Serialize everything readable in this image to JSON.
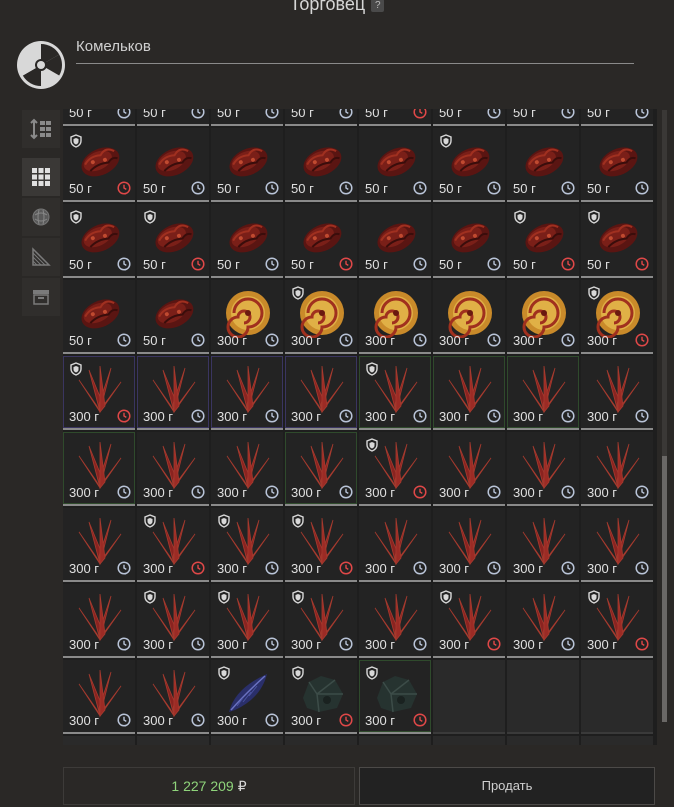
{
  "header": {
    "title": "Торговец",
    "help": "?"
  },
  "trader": {
    "name": "Комельков"
  },
  "toolbar": {
    "items": [
      "sort-icon",
      "grid-view-icon",
      "orb-filter-icon",
      "pattern-filter-icon",
      "box-filter-icon"
    ]
  },
  "colors": {
    "price_total": "#8fd47b",
    "clock_normal": "#b9c4d8",
    "clock_expiring": "#e04848"
  },
  "inventory": {
    "items": [
      {
        "price": "50 г",
        "type": "meat",
        "lock": false,
        "exp": false,
        "rar": ""
      },
      {
        "price": "50 г",
        "type": "meat",
        "lock": false,
        "exp": false,
        "rar": ""
      },
      {
        "price": "50 г",
        "type": "meat",
        "lock": false,
        "exp": false,
        "rar": ""
      },
      {
        "price": "50 г",
        "type": "meat",
        "lock": false,
        "exp": false,
        "rar": ""
      },
      {
        "price": "50 г",
        "type": "meat",
        "lock": false,
        "exp": true,
        "rar": ""
      },
      {
        "price": "50 г",
        "type": "meat",
        "lock": false,
        "exp": false,
        "rar": ""
      },
      {
        "price": "50 г",
        "type": "meat",
        "lock": false,
        "exp": false,
        "rar": ""
      },
      {
        "price": "50 г",
        "type": "meat",
        "lock": false,
        "exp": false,
        "rar": ""
      },
      {
        "price": "50 г",
        "type": "meat",
        "lock": true,
        "exp": true,
        "rar": ""
      },
      {
        "price": "50 г",
        "type": "meat",
        "lock": false,
        "exp": false,
        "rar": ""
      },
      {
        "price": "50 г",
        "type": "meat",
        "lock": false,
        "exp": false,
        "rar": ""
      },
      {
        "price": "50 г",
        "type": "meat",
        "lock": false,
        "exp": false,
        "rar": ""
      },
      {
        "price": "50 г",
        "type": "meat",
        "lock": false,
        "exp": false,
        "rar": ""
      },
      {
        "price": "50 г",
        "type": "meat",
        "lock": true,
        "exp": false,
        "rar": ""
      },
      {
        "price": "50 г",
        "type": "meat",
        "lock": false,
        "exp": false,
        "rar": ""
      },
      {
        "price": "50 г",
        "type": "meat",
        "lock": false,
        "exp": false,
        "rar": ""
      },
      {
        "price": "50 г",
        "type": "meat",
        "lock": true,
        "exp": false,
        "rar": ""
      },
      {
        "price": "50 г",
        "type": "meat",
        "lock": true,
        "exp": true,
        "rar": ""
      },
      {
        "price": "50 г",
        "type": "meat",
        "lock": false,
        "exp": false,
        "rar": ""
      },
      {
        "price": "50 г",
        "type": "meat",
        "lock": false,
        "exp": true,
        "rar": ""
      },
      {
        "price": "50 г",
        "type": "meat",
        "lock": false,
        "exp": false,
        "rar": ""
      },
      {
        "price": "50 г",
        "type": "meat",
        "lock": false,
        "exp": false,
        "rar": ""
      },
      {
        "price": "50 г",
        "type": "meat",
        "lock": true,
        "exp": true,
        "rar": ""
      },
      {
        "price": "50 г",
        "type": "meat",
        "lock": true,
        "exp": true,
        "rar": ""
      },
      {
        "price": "50 г",
        "type": "meat",
        "lock": false,
        "exp": false,
        "rar": ""
      },
      {
        "price": "50 г",
        "type": "meat",
        "lock": false,
        "exp": false,
        "rar": ""
      },
      {
        "price": "300 г",
        "type": "swirl",
        "lock": false,
        "exp": false,
        "rar": ""
      },
      {
        "price": "300 г",
        "type": "swirl",
        "lock": true,
        "exp": false,
        "rar": ""
      },
      {
        "price": "300 г",
        "type": "swirl",
        "lock": false,
        "exp": false,
        "rar": ""
      },
      {
        "price": "300 г",
        "type": "swirl",
        "lock": false,
        "exp": false,
        "rar": ""
      },
      {
        "price": "300 г",
        "type": "swirl",
        "lock": false,
        "exp": false,
        "rar": ""
      },
      {
        "price": "300 г",
        "type": "swirl",
        "lock": true,
        "exp": true,
        "rar": ""
      },
      {
        "price": "300 г",
        "type": "crystal",
        "lock": true,
        "exp": true,
        "rar": "purple"
      },
      {
        "price": "300 г",
        "type": "crystal",
        "lock": false,
        "exp": false,
        "rar": "purple"
      },
      {
        "price": "300 г",
        "type": "crystal",
        "lock": false,
        "exp": false,
        "rar": "purple"
      },
      {
        "price": "300 г",
        "type": "crystal",
        "lock": false,
        "exp": false,
        "rar": "purple"
      },
      {
        "price": "300 г",
        "type": "crystal",
        "lock": true,
        "exp": false,
        "rar": "green"
      },
      {
        "price": "300 г",
        "type": "crystal",
        "lock": false,
        "exp": false,
        "rar": "green"
      },
      {
        "price": "300 г",
        "type": "crystal",
        "lock": false,
        "exp": false,
        "rar": "green"
      },
      {
        "price": "300 г",
        "type": "crystal",
        "lock": false,
        "exp": false,
        "rar": ""
      },
      {
        "price": "300 г",
        "type": "crystal",
        "lock": false,
        "exp": false,
        "rar": "green"
      },
      {
        "price": "300 г",
        "type": "crystal",
        "lock": false,
        "exp": false,
        "rar": ""
      },
      {
        "price": "300 г",
        "type": "crystal",
        "lock": false,
        "exp": false,
        "rar": ""
      },
      {
        "price": "300 г",
        "type": "crystal",
        "lock": false,
        "exp": false,
        "rar": "green"
      },
      {
        "price": "300 г",
        "type": "crystal",
        "lock": true,
        "exp": true,
        "rar": ""
      },
      {
        "price": "300 г",
        "type": "crystal",
        "lock": false,
        "exp": false,
        "rar": ""
      },
      {
        "price": "300 г",
        "type": "crystal",
        "lock": false,
        "exp": false,
        "rar": ""
      },
      {
        "price": "300 г",
        "type": "crystal",
        "lock": false,
        "exp": false,
        "rar": ""
      },
      {
        "price": "300 г",
        "type": "crystal",
        "lock": false,
        "exp": false,
        "rar": ""
      },
      {
        "price": "300 г",
        "type": "crystal",
        "lock": true,
        "exp": true,
        "rar": ""
      },
      {
        "price": "300 г",
        "type": "crystal",
        "lock": true,
        "exp": false,
        "rar": ""
      },
      {
        "price": "300 г",
        "type": "crystal",
        "lock": true,
        "exp": true,
        "rar": ""
      },
      {
        "price": "300 г",
        "type": "crystal",
        "lock": false,
        "exp": false,
        "rar": ""
      },
      {
        "price": "300 г",
        "type": "crystal",
        "lock": false,
        "exp": false,
        "rar": ""
      },
      {
        "price": "300 г",
        "type": "crystal",
        "lock": false,
        "exp": false,
        "rar": ""
      },
      {
        "price": "300 г",
        "type": "crystal",
        "lock": false,
        "exp": false,
        "rar": ""
      },
      {
        "price": "300 г",
        "type": "crystal",
        "lock": false,
        "exp": false,
        "rar": ""
      },
      {
        "price": "300 г",
        "type": "crystal",
        "lock": true,
        "exp": false,
        "rar": ""
      },
      {
        "price": "300 г",
        "type": "crystal",
        "lock": true,
        "exp": false,
        "rar": ""
      },
      {
        "price": "300 г",
        "type": "crystal",
        "lock": true,
        "exp": false,
        "rar": ""
      },
      {
        "price": "300 г",
        "type": "crystal",
        "lock": false,
        "exp": false,
        "rar": ""
      },
      {
        "price": "300 г",
        "type": "crystal",
        "lock": true,
        "exp": true,
        "rar": ""
      },
      {
        "price": "300 г",
        "type": "crystal",
        "lock": false,
        "exp": false,
        "rar": ""
      },
      {
        "price": "300 г",
        "type": "crystal",
        "lock": true,
        "exp": true,
        "rar": ""
      },
      {
        "price": "300 г",
        "type": "crystal",
        "lock": false,
        "exp": false,
        "rar": ""
      },
      {
        "price": "300 г",
        "type": "crystal",
        "lock": false,
        "exp": false,
        "rar": ""
      },
      {
        "price": "300 г",
        "type": "feather",
        "lock": true,
        "exp": false,
        "rar": ""
      },
      {
        "price": "300 г",
        "type": "rock",
        "lock": true,
        "exp": true,
        "rar": ""
      },
      {
        "price": "300 г",
        "type": "rock",
        "lock": true,
        "exp": true,
        "rar": "green"
      },
      {
        "type": "empty"
      },
      {
        "type": "empty"
      },
      {
        "type": "empty"
      },
      {
        "type": "empty"
      },
      {
        "type": "empty"
      },
      {
        "type": "empty"
      },
      {
        "type": "empty"
      },
      {
        "type": "empty"
      },
      {
        "type": "empty"
      },
      {
        "type": "empty"
      },
      {
        "type": "empty"
      }
    ]
  },
  "footer": {
    "total": "1 227 209",
    "currency": "₽",
    "sell_label": "Продать"
  }
}
